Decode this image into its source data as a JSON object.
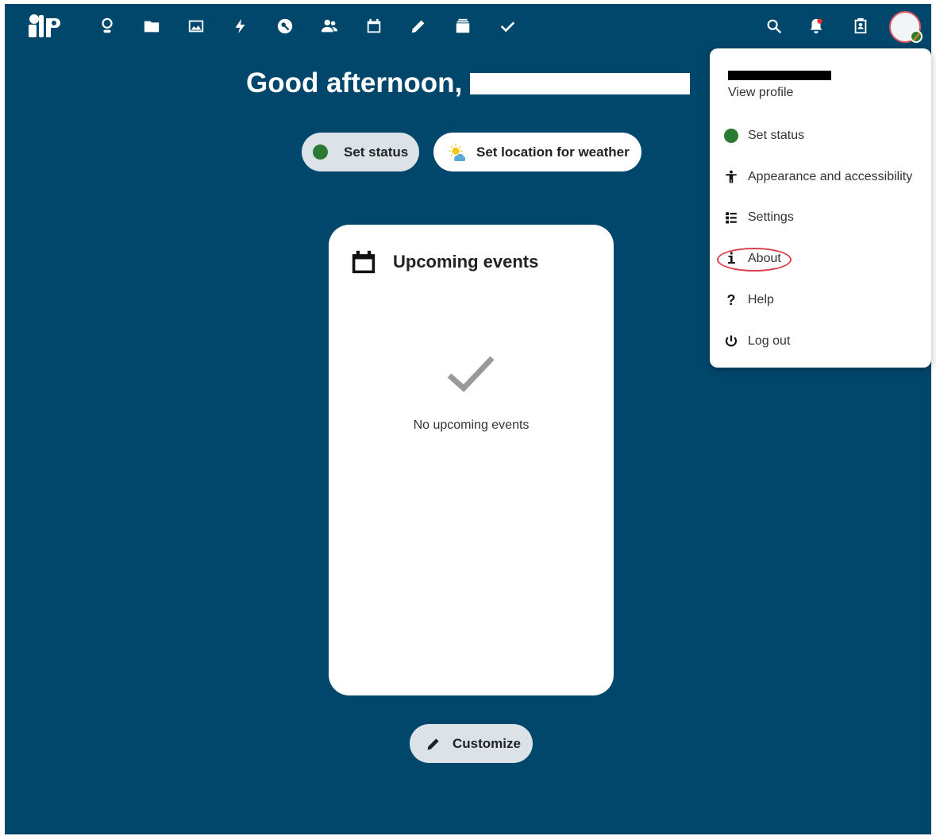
{
  "topbar": {
    "apps": [
      {
        "name": "dashboard",
        "icon": "dashboard-icon"
      },
      {
        "name": "files",
        "icon": "folder-icon"
      },
      {
        "name": "photos",
        "icon": "image-icon"
      },
      {
        "name": "activity",
        "icon": "lightning-icon"
      },
      {
        "name": "passwords",
        "icon": "key-icon"
      },
      {
        "name": "contacts",
        "icon": "contacts-icon"
      },
      {
        "name": "calendar",
        "icon": "calendar-icon"
      },
      {
        "name": "notes",
        "icon": "pencil-icon"
      },
      {
        "name": "deck",
        "icon": "deck-icon"
      },
      {
        "name": "tasks",
        "icon": "check-icon"
      }
    ],
    "right_icons": [
      "search-icon",
      "notifications-icon",
      "contacts-menu-icon"
    ]
  },
  "greeting": {
    "text": "Good afternoon,"
  },
  "status_button": {
    "label": "Set status"
  },
  "weather_button": {
    "label": "Set location for weather"
  },
  "events_widget": {
    "title": "Upcoming events",
    "empty_text": "No upcoming events"
  },
  "customize_button": {
    "label": "Customize"
  },
  "user_menu": {
    "view_profile": "View profile",
    "items": [
      {
        "label": "Set status",
        "icon": "status-dot-icon"
      },
      {
        "label": "Appearance and accessibility",
        "icon": "accessibility-icon"
      },
      {
        "label": "Settings",
        "icon": "settings-list-icon"
      },
      {
        "label": "About",
        "icon": "info-icon"
      },
      {
        "label": "Help",
        "icon": "help-icon"
      },
      {
        "label": "Log out",
        "icon": "power-icon"
      }
    ]
  },
  "colors": {
    "background": "#00476b",
    "status_online": "#2a7a32",
    "highlight": "#d9414e"
  }
}
